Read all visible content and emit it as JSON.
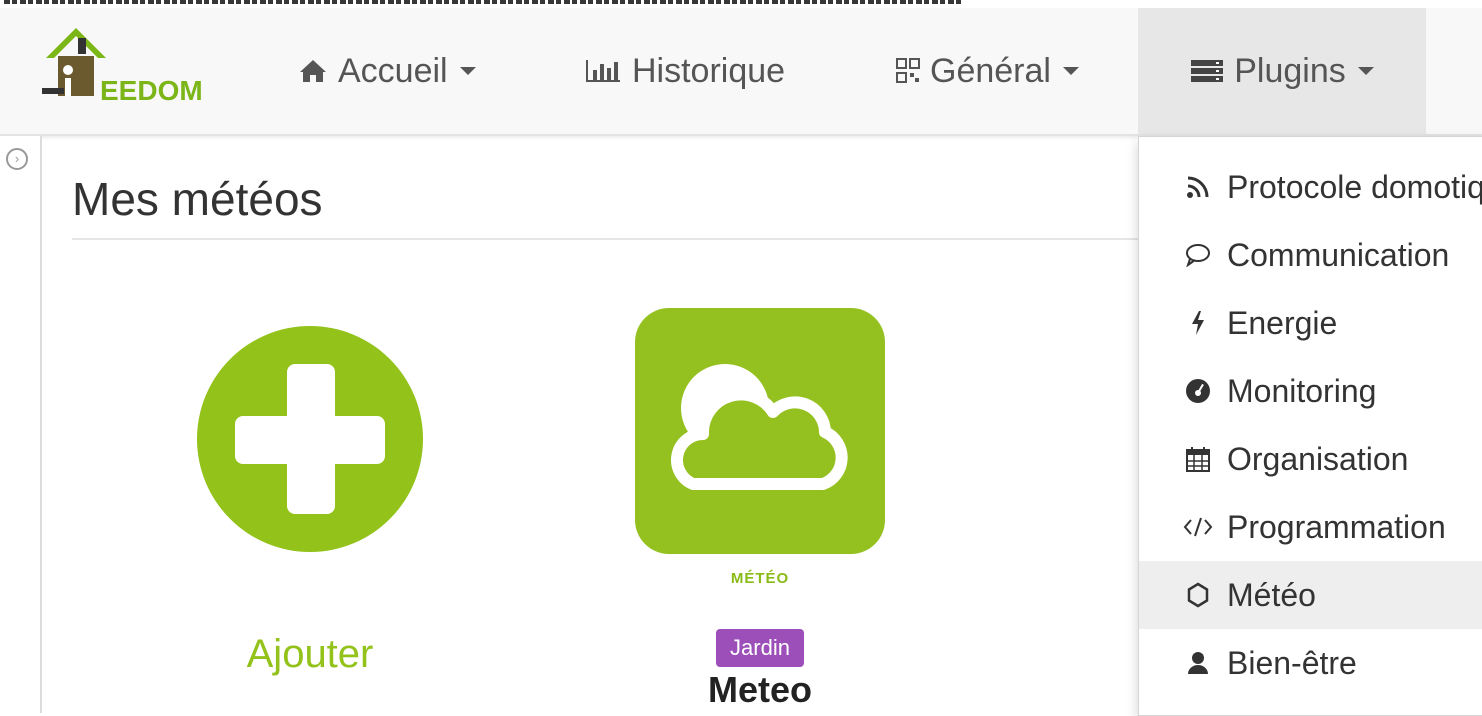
{
  "app": {
    "logo_text": "EEDOM"
  },
  "nav": {
    "accueil": "Accueil",
    "historique": "Historique",
    "general": "Général",
    "plugins": "Plugins"
  },
  "page": {
    "title": "Mes météos"
  },
  "cards": {
    "add_label": "Ajouter",
    "meteo_brand": "MÉTÉO",
    "object_badge": "Jardin",
    "object_name": "Meteo"
  },
  "plugins_menu": {
    "items": [
      {
        "label": "Protocole domotique",
        "icon": "rss-icon"
      },
      {
        "label": "Communication",
        "icon": "speech-bubble-icon"
      },
      {
        "label": "Energie",
        "icon": "bolt-icon"
      },
      {
        "label": "Monitoring",
        "icon": "dashboard-icon"
      },
      {
        "label": "Organisation",
        "icon": "calendar-icon"
      },
      {
        "label": "Programmation",
        "icon": "code-icon"
      },
      {
        "label": "Météo",
        "icon": "sun-icon",
        "active": true
      },
      {
        "label": "Bien-être",
        "icon": "user-icon"
      }
    ]
  },
  "colors": {
    "accent_green": "#93c21a",
    "badge_purple": "#9c4fb8",
    "navbar_bg": "#f8f8f8"
  }
}
